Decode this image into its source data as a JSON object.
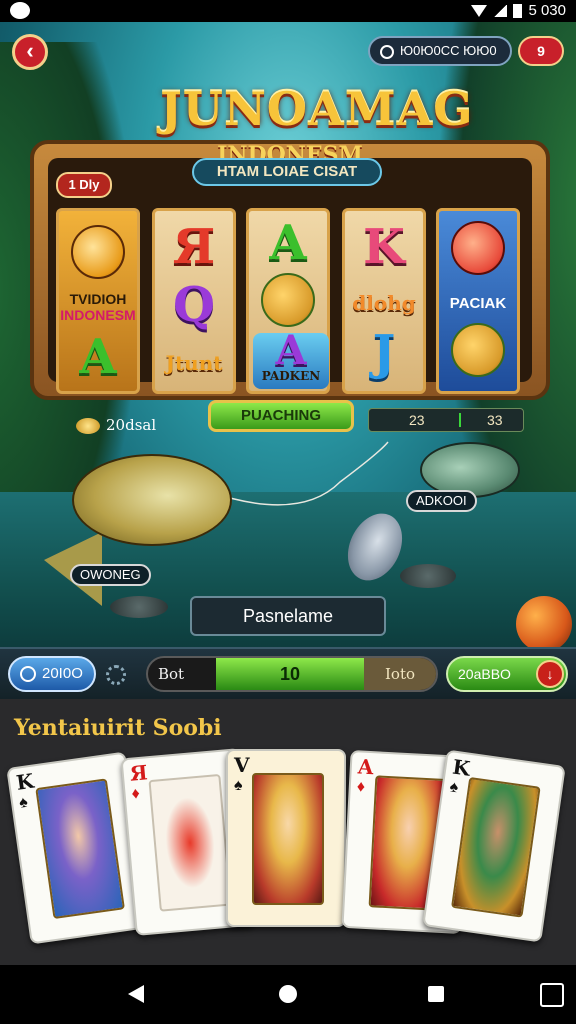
{
  "status_bar": {
    "time": "5 030"
  },
  "header": {
    "top_pill": "Ю0Ю0СС ЮЮ0",
    "top_right_button": "9",
    "title": "JUNOAMAG",
    "subtitle": "INDONESM"
  },
  "slot": {
    "banner": "HTAM LOIAE CISAT",
    "ribbon_tag": "1 Dly",
    "reel1": {
      "text_top": "TVIDIOH",
      "text_sub": "INDONESM",
      "bottom": "A"
    },
    "reel2": {
      "top": "Я",
      "mid": "Q",
      "bottom": "Jtunt"
    },
    "reel3": {
      "top": "A",
      "bottom": "PADKEN"
    },
    "reel4": {
      "top": "K",
      "mid": "dlohg",
      "bottom": "J"
    },
    "reel5": {
      "mid": "PACIAK"
    },
    "spin_button": "PUACHING",
    "coins_left": "20dsal",
    "stats": {
      "left": "23",
      "right": "33"
    }
  },
  "fish": {
    "label_left": "OWONEG",
    "label_right": "ADKOOI"
  },
  "primary_button": "Pasnelame",
  "controls": {
    "left_value": "20I0O",
    "bet_label": "Bot",
    "bet_value": "10",
    "bet_fill_percent": 51,
    "bet_right": "Ioto",
    "right_value": "20aBBO"
  },
  "cards_section": {
    "title": "Yentaiuirit Soobi",
    "cards": [
      {
        "rank": "K",
        "suit": "♠",
        "suit_color": "black"
      },
      {
        "rank": "Я",
        "suit": "♦",
        "suit_color": "red"
      },
      {
        "rank": "V",
        "suit": "♠",
        "suit_color": "black"
      },
      {
        "rank": "A",
        "suit": "♦",
        "suit_color": "red"
      },
      {
        "rank": "K",
        "suit": "♠",
        "suit_color": "black"
      }
    ]
  },
  "colors": {
    "accent_gold": "#f7c43a",
    "spin_green": "#8ee84a",
    "back_red": "#c8202a",
    "card_title": "#f2c64a"
  },
  "icons": {
    "back": "chevron-left-icon",
    "coin": "coin-icon",
    "gear": "gear-icon",
    "down": "arrow-down-icon"
  }
}
